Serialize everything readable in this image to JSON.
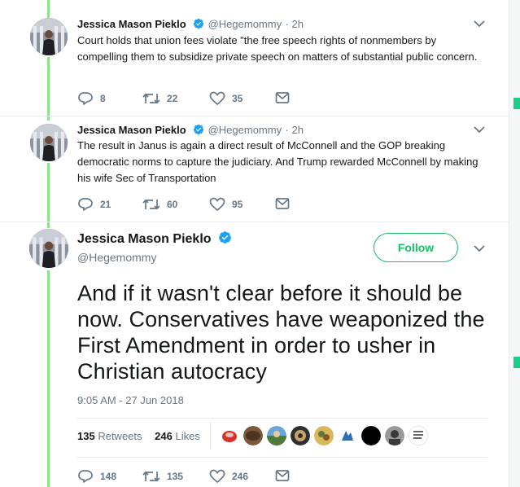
{
  "tweets": [
    {
      "name": "Jessica Mason Pieklo",
      "handle": "@Hegemommy",
      "time": "2h",
      "text": "Court holds that union fees violate \"the free speech rights of nonmembers by compelling them to subsidize private speech on matters of substantial public concern.",
      "replies": "8",
      "retweets": "22",
      "likes": "35"
    },
    {
      "name": "Jessica Mason Pieklo",
      "handle": "@Hegemommy",
      "time": "2h",
      "text": "The result in Janus is again a direct result of McConnell and the GOP breaking democratic norms to capture the judiciary. And Trump rewarded McConnell by making his wife Sec of Transportation",
      "replies": "21",
      "retweets": "60",
      "likes": "95"
    }
  ],
  "main_tweet": {
    "name": "Jessica Mason Pieklo",
    "handle": "@Hegemommy",
    "follow_label": "Follow",
    "text": "And if it wasn't clear before it should be now. Conservatives have weaponized the First Amendment in order to usher in Christian autocracy",
    "timestamp": "9:05 AM - 27 Jun 2018",
    "retweet_count": "135",
    "retweet_label": "Retweets",
    "like_count": "246",
    "like_label": "Likes",
    "replies": "148",
    "retweets": "135",
    "likes": "246"
  },
  "colors": {
    "accent_green": "#17bf63",
    "verified_blue": "#1da1f2",
    "thread_line": "#8ee08a",
    "muted_text": "#657786"
  },
  "icons": [
    "verified-badge-icon",
    "chevron-down-icon",
    "reply-icon",
    "retweet-icon",
    "like-icon",
    "direct-message-icon"
  ]
}
